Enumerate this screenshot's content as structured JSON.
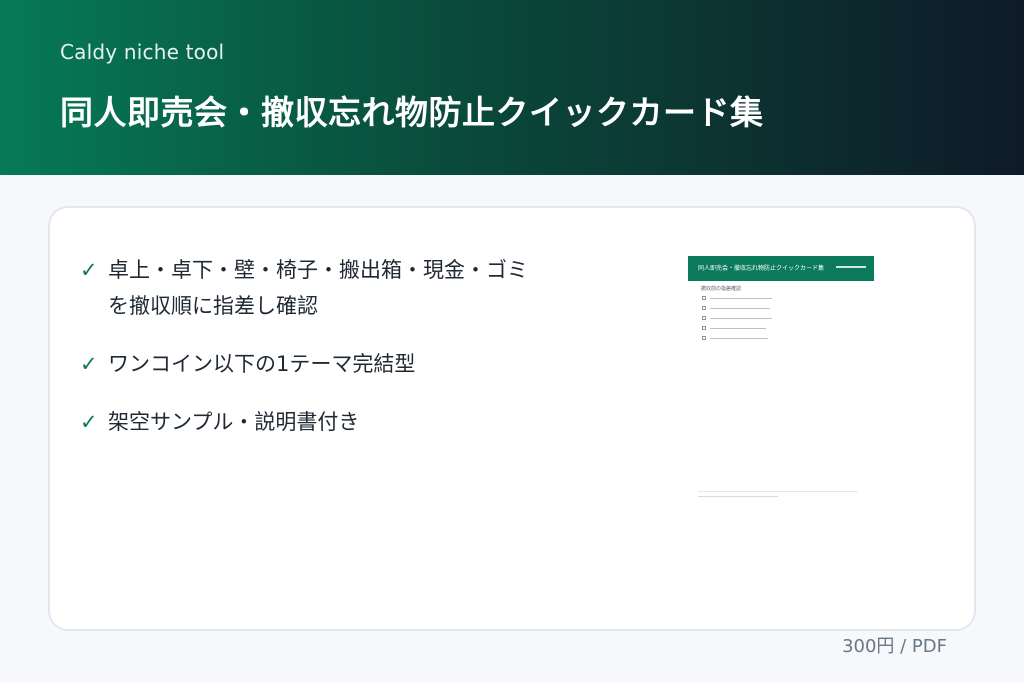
{
  "header": {
    "subtitle": "Caldy niche tool",
    "title": "同人即売会・撤収忘れ物防止クイックカード集"
  },
  "features": [
    {
      "icon": "check-icon",
      "text": "卓上・卓下・壁・椅子・搬出箱・現金・ゴミを撤収順に指差し確認"
    },
    {
      "icon": "check-icon",
      "text": "ワンコイン以下の1テーマ完結型"
    },
    {
      "icon": "check-icon",
      "text": "架空サンプル・説明書付き"
    }
  ],
  "thumbnail": {
    "header_text": "同人即売会・撤収忘れ物防止クイックカード集",
    "section_text": "撤収前の指差確認",
    "row_count": 5
  },
  "price": "300円 / PDF",
  "colors": {
    "accent": "#0b7a5a",
    "header_start": "#067a55",
    "header_end": "#0e1a28"
  }
}
